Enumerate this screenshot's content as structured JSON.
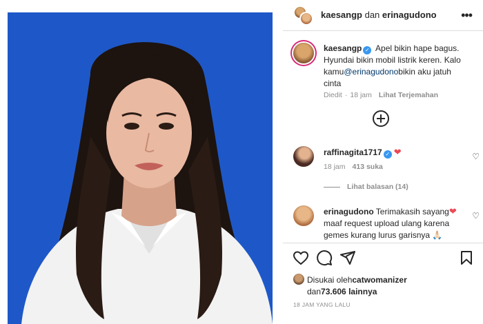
{
  "header": {
    "user1": "kaesangp",
    "joiner": " dan ",
    "user2": "erinagudono",
    "more_icon": "more-horizontal-icon"
  },
  "caption": {
    "username": "kaesangp",
    "verified_icon": "verified-badge-icon",
    "text_part1": "Apel bikin hape bagus. Hyundai bikin mobil listrik keren. Kalo kamu",
    "mention": "@erinagudono",
    "text_part2": "bikin aku jatuh cinta",
    "edited": "Diedit",
    "time": "18 jam",
    "translate": "Lihat Terjemahan"
  },
  "load_more_icon": "plus-circle-icon",
  "comments": [
    {
      "username": "raffinagita1717",
      "verified": true,
      "text": "",
      "emoji": "❤",
      "time": "18 jam",
      "likes": "413 suka",
      "view_replies": "Lihat balasan (14)"
    },
    {
      "username": "erinagudono",
      "verified": false,
      "text_part1": "Terimakasih sayang",
      "emoji": "❤",
      "text_part2": " maaf request upload ulang karena gemes kurang lurus garisnya",
      "trailing_emoji": "🙏🏻"
    }
  ],
  "actions": {
    "like": "heart-icon",
    "comment": "comment-icon",
    "share": "send-icon",
    "save": "bookmark-icon"
  },
  "likes": {
    "prefix": "Disukai oleh",
    "user": "catwomanizer",
    "joiner": "dan",
    "count": "73.606",
    "suffix": " lainnya"
  },
  "timestamp": "18 JAM YANG LALU",
  "colors": {
    "photo_background": "#1e58c8",
    "heart": "#ed4956",
    "mention": "#00376b",
    "verified": "#3897f0",
    "secondary_text": "#8e8e8e"
  }
}
